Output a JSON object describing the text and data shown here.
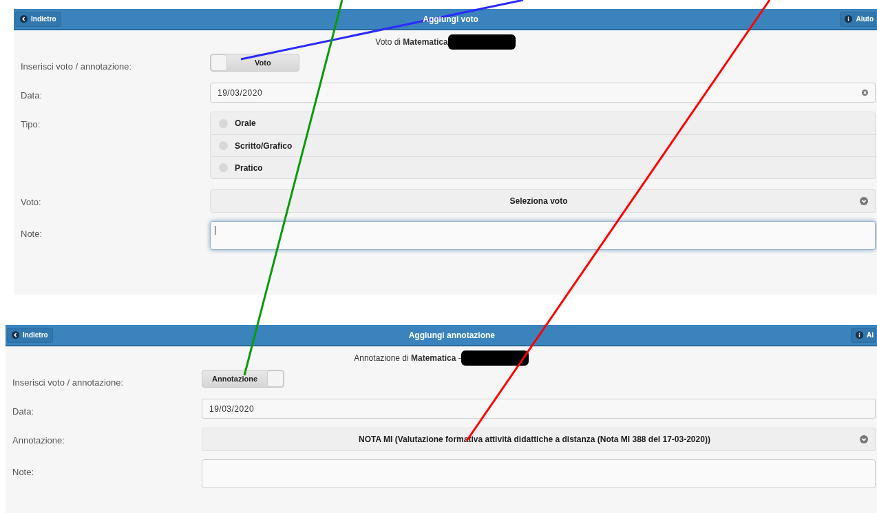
{
  "panels": [
    {
      "header": {
        "back": "Indietro",
        "title": "Aggiungi voto",
        "help": "Aiuto"
      },
      "subtitle": "Voto di **Matematica**",
      "fields": [
        {
          "kind": "toggle",
          "label": "Inserisci voto / annotazione:",
          "value": "Voto",
          "on": false
        },
        {
          "kind": "date",
          "label": "Data:",
          "value": "19/03/2020",
          "clearable": true
        },
        {
          "kind": "radio",
          "label": "Tipo:",
          "options": [
            {
              "label": "Orale",
              "selected": false
            },
            {
              "label": "Scritto/Grafico",
              "selected": false
            },
            {
              "label": "Pratico",
              "selected": false
            }
          ]
        },
        {
          "kind": "select",
          "label": "Voto:",
          "value": "Seleziona voto"
        },
        {
          "kind": "textarea",
          "label": "Note:",
          "focused": true
        }
      ]
    },
    {
      "header": {
        "back": "Indietro",
        "title": "Aggiungi annotazione",
        "help": "Ai"
      },
      "subtitle": "Annotazione di **Matematica** - ",
      "fields": [
        {
          "kind": "toggle",
          "label": "Inserisci voto / annotazione:",
          "value": "Annotazione",
          "on": true
        },
        {
          "kind": "date",
          "label": "Data:",
          "value": "19/03/2020",
          "clearable": false
        },
        {
          "kind": "select",
          "label": "Annotazione:",
          "value": "NOTA MI (Valutazione formativa attività didattiche a distanza (Nota MI 388 del 17-03-2020))"
        },
        {
          "kind": "textarea",
          "label": "Note:",
          "focused": false
        }
      ]
    }
  ]
}
